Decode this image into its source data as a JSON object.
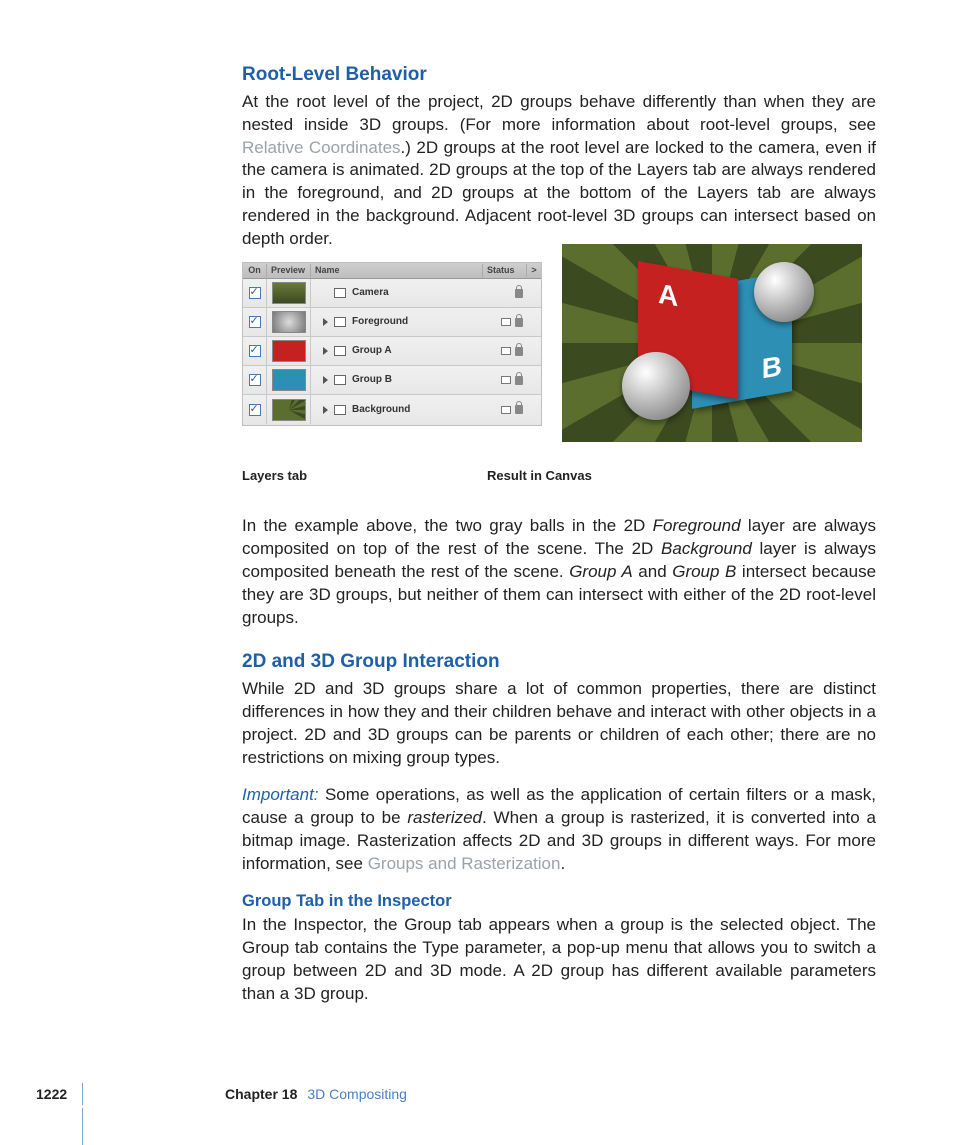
{
  "section1": {
    "title": "Root-Level Behavior",
    "para_a": "At the root level of the project, 2D groups behave differently than when they are nested inside 3D groups. (For more information about root-level groups, see ",
    "link1": "Relative Coordinates",
    "para_b": ".) 2D groups at the root level are locked to the camera, even if the camera is animated. 2D groups at the top of the Layers tab are always rendered in the foreground, and 2D groups at the bottom of the Layers tab are always rendered in the background. Adjacent root-level 3D groups can intersect based on depth order."
  },
  "layers_panel": {
    "headers": {
      "on": "On",
      "preview": "Preview",
      "name": "Name",
      "status": "Status",
      "arrow": ">"
    },
    "rows": [
      {
        "label": "Camera",
        "has_triangle": false,
        "thumb_bg": "linear-gradient(#6a7a3a,#3b4a1f)"
      },
      {
        "label": "Foreground",
        "has_triangle": true,
        "thumb_bg": "radial-gradient(circle,#dcdcdc,#777)"
      },
      {
        "label": "Group A",
        "has_triangle": true,
        "thumb_bg": "#c62121"
      },
      {
        "label": "Group B",
        "has_triangle": true,
        "thumb_bg": "#2e8fb5"
      },
      {
        "label": "Background",
        "has_triangle": true,
        "thumb_bg": "conic-gradient(#5b6e2e 0 15deg,#3b4a1f 15deg 30deg,#5b6e2e 30deg 45deg,#3b4a1f 45deg 60deg,#5b6e2e 60deg 75deg,#3b4a1f 75deg 90deg,#5b6e2e 90deg 105deg,#3b4a1f 105deg 120deg,#5b6e2e 120deg 360deg)"
      }
    ],
    "card_a": "A",
    "card_b": "B"
  },
  "captions": {
    "left": "Layers tab",
    "right": "Result in Canvas"
  },
  "example_para": {
    "a": "In the example above, the two gray balls in the 2D ",
    "i1": "Foreground",
    "b": " layer are always composited on top of the rest of the scene. The 2D ",
    "i2": "Background",
    "c": " layer is always composited beneath the rest of the scene. ",
    "i3": "Group A",
    "d": " and ",
    "i4": "Group B",
    "e": " intersect because they are 3D groups, but neither of them can intersect with either of the 2D root-level groups."
  },
  "section2": {
    "title": "2D and 3D Group Interaction",
    "para1": "While 2D and 3D groups share a lot of common properties, there are distinct differences in how they and their children behave and interact with other objects in a project. 2D and 3D groups can be parents or children of each other; there are no restrictions on mixing group types.",
    "important_label": "Important:  ",
    "important_a": "Some operations, as well as the application of certain filters or a mask, cause a group to be ",
    "important_i": "rasterized",
    "important_b": ". When a group is rasterized, it is converted into a bitmap image. Rasterization affects 2D and 3D groups in different ways. For more information, see ",
    "important_link": "Groups and Rasterization",
    "important_c": "."
  },
  "section3": {
    "title": "Group Tab in the Inspector",
    "para": "In the Inspector, the Group tab appears when a group is the selected object. The Group tab contains the Type parameter, a pop-up menu that allows you to switch a group between 2D and 3D mode. A 2D group has different available parameters than a 3D group."
  },
  "footer": {
    "page": "1222",
    "chapter_label": "Chapter 18",
    "chapter_title": "3D Compositing"
  }
}
